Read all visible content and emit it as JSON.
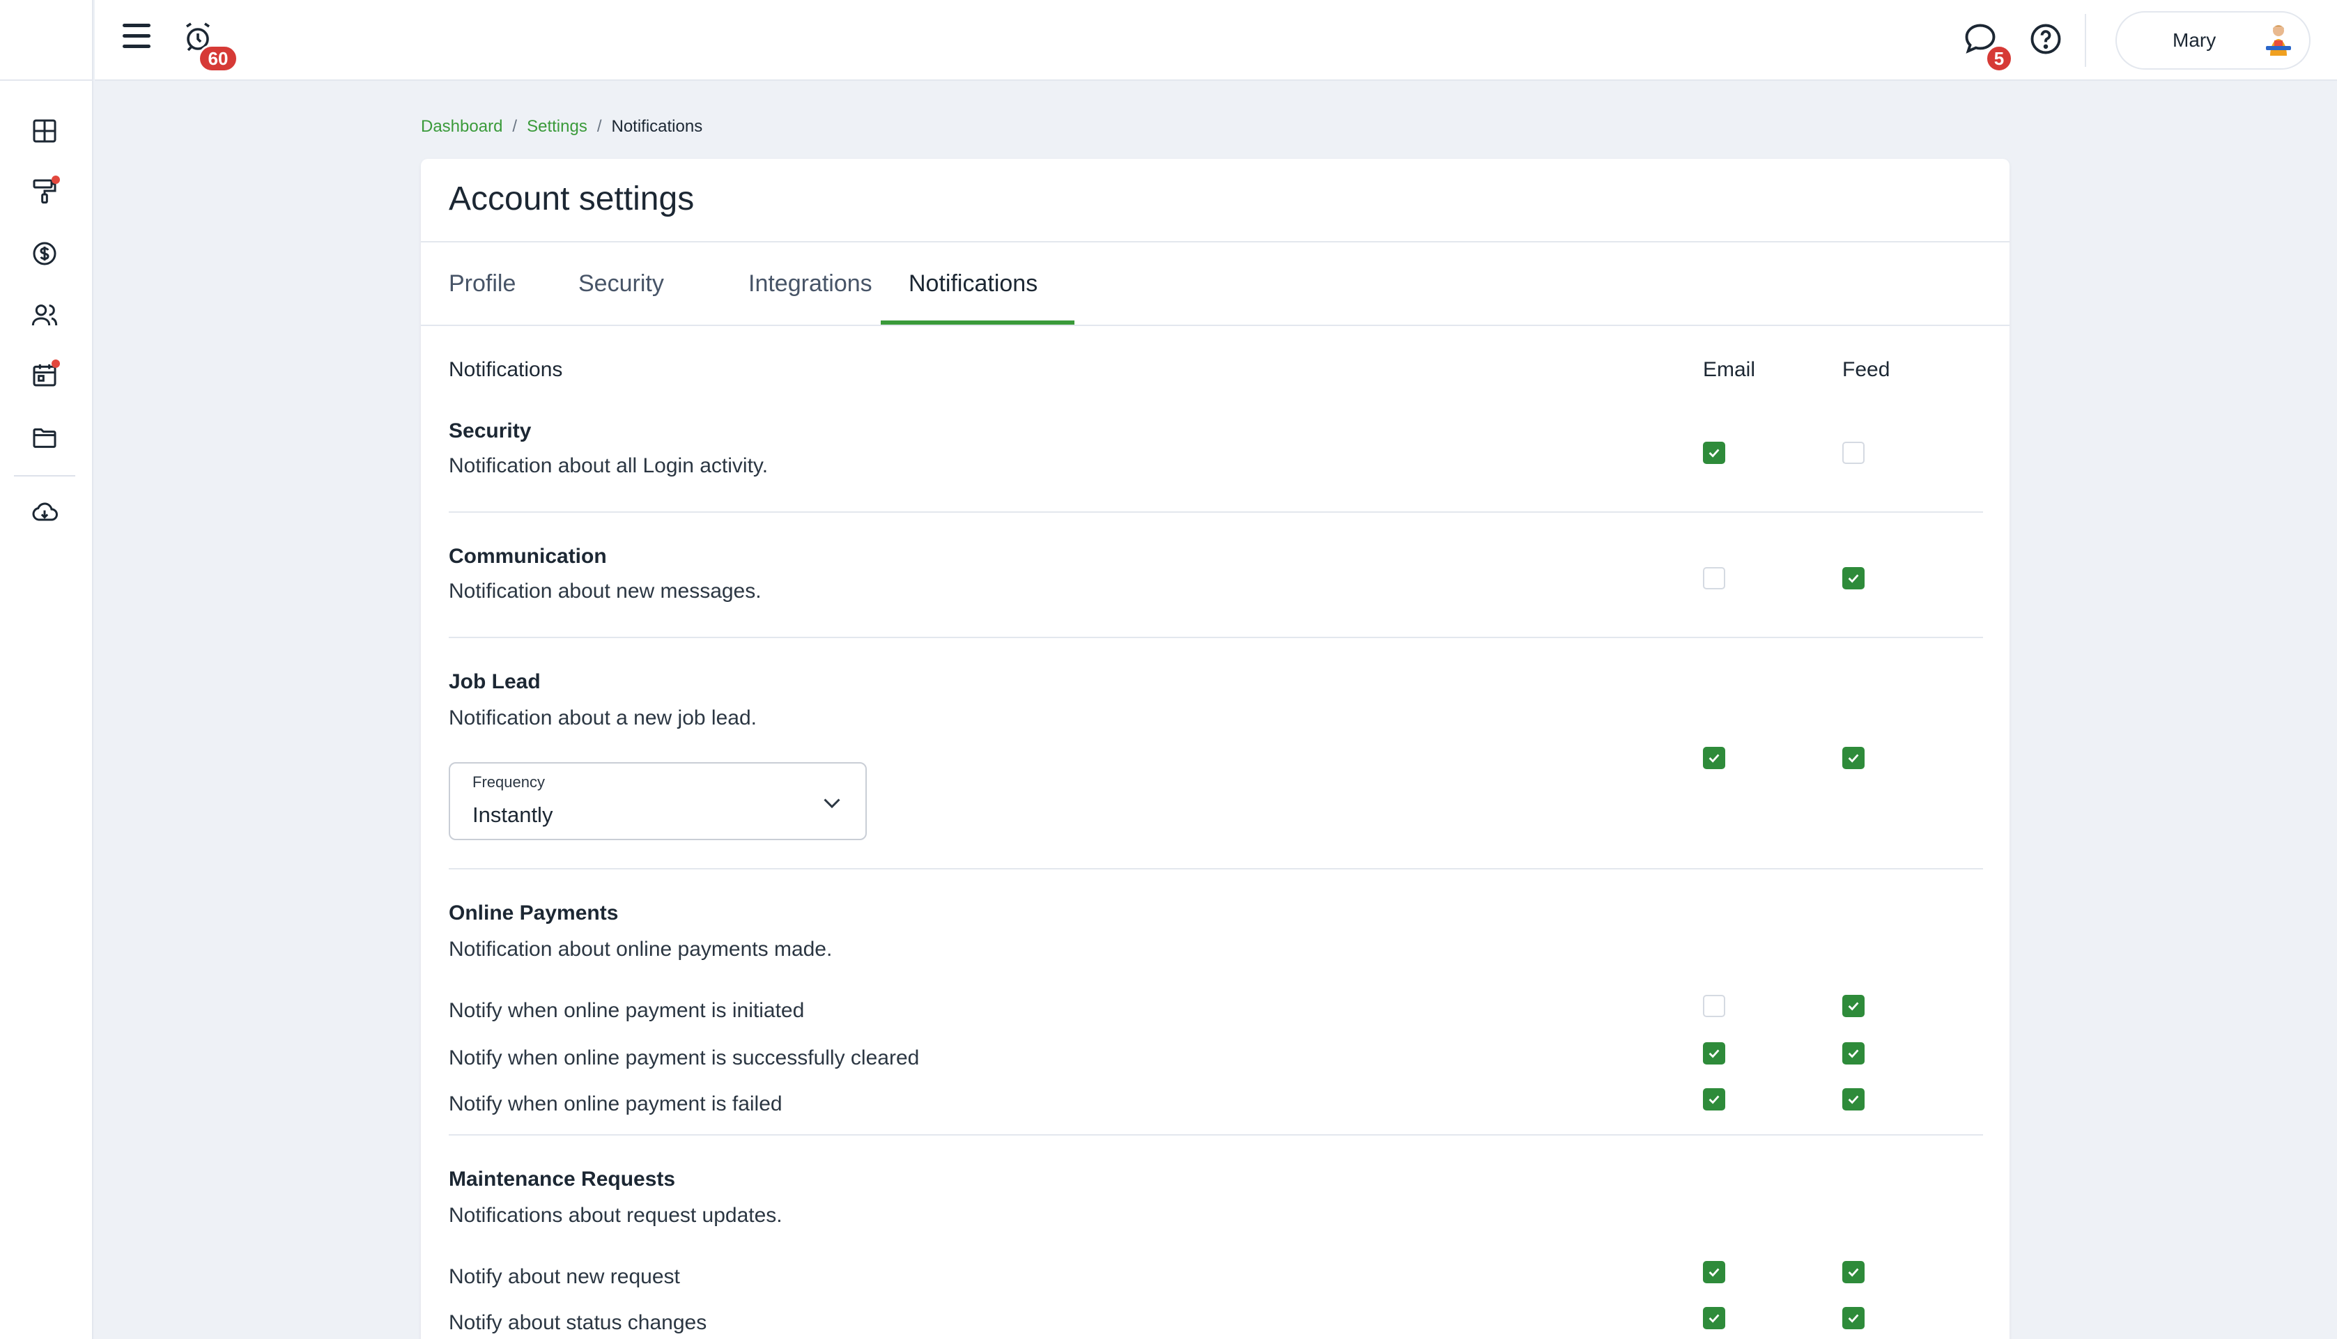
{
  "topbar": {
    "alarm_count": "60",
    "messages_count": "5",
    "user_name": "Mary"
  },
  "breadcrumb": {
    "dashboard": "Dashboard",
    "settings": "Settings",
    "current": "Notifications",
    "separator": "/"
  },
  "card": {
    "title": "Account settings",
    "tabs": [
      "Profile",
      "Security",
      "Integrations",
      "Notifications"
    ],
    "active_tab": "Notifications"
  },
  "columns": {
    "section": "Notifications",
    "email": "Email",
    "feed": "Feed"
  },
  "sections": {
    "security": {
      "title": "Security",
      "desc": "Notification about all Login activity.",
      "email": true,
      "feed": false
    },
    "communication": {
      "title": "Communication",
      "desc": "Notification about new messages.",
      "email": false,
      "feed": true
    },
    "job_lead": {
      "title": "Job Lead",
      "desc": "Notification about a new job lead.",
      "email": true,
      "feed": true,
      "frequency_label": "Frequency",
      "frequency_value": "Instantly"
    },
    "online_payments": {
      "title": "Online Payments",
      "desc": "Notification about online payments made.",
      "rows": [
        {
          "label": "Notify when online payment is initiated",
          "email": false,
          "feed": true
        },
        {
          "label": "Notify when online payment is successfully cleared",
          "email": true,
          "feed": true
        },
        {
          "label": "Notify when online payment is failed",
          "email": true,
          "feed": true
        }
      ]
    },
    "maintenance": {
      "title": "Maintenance Requests",
      "desc": "Notifications about request updates.",
      "rows": [
        {
          "label": "Notify about new request",
          "email": true,
          "feed": true
        },
        {
          "label": "Notify about status changes",
          "email": true,
          "feed": true
        }
      ]
    }
  },
  "colors": {
    "accent": "#3a9a3a",
    "checkbox_on": "#2e8b3a",
    "badge": "#d63a36",
    "background": "#eef1f6"
  },
  "icons": {
    "sidebar": [
      "dashboard-icon",
      "paint-roller-icon",
      "dollar-icon",
      "people-icon",
      "calendar-icon",
      "folder-icon",
      "cloud-download-icon"
    ]
  }
}
